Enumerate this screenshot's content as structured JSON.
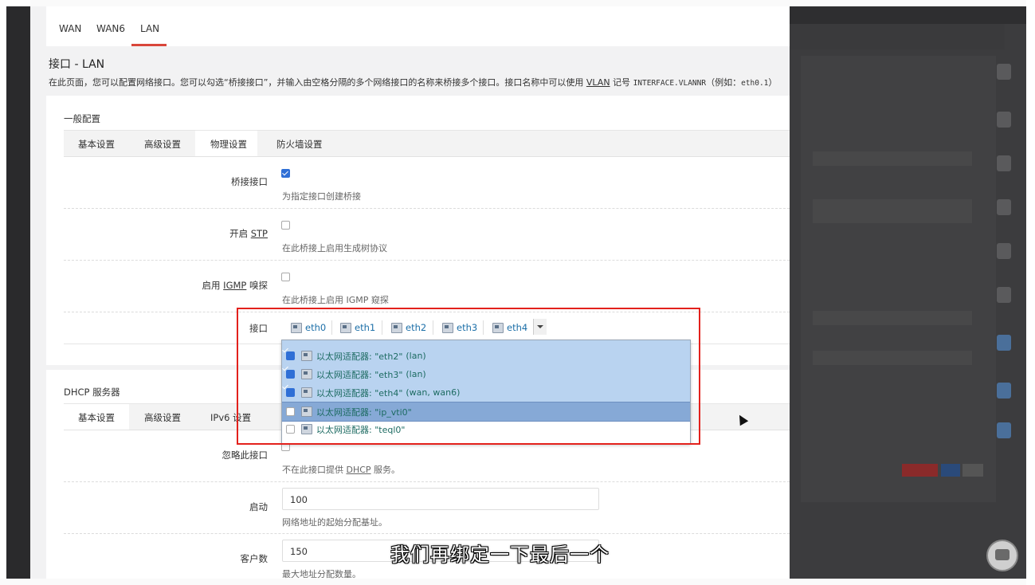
{
  "top_tabs": [
    {
      "label": "WAN"
    },
    {
      "label": "WAN6"
    },
    {
      "label": "LAN"
    }
  ],
  "page": {
    "title": "接口 - LAN",
    "desc_part1": "在此页面，您可以配置网络接口。您可以勾选“桥接接口”，并输入由空格分隔的多个网络接口的名称来桥接多个接口。接口名称中可以使用 ",
    "desc_vlan": "VLAN",
    "desc_part2": " 记号 ",
    "desc_mono": "INTERFACE.VLANNR",
    "desc_part3": "（例如：",
    "desc_mono2": "eth0.1",
    "desc_part4": "）"
  },
  "general": {
    "title": "一般配置",
    "tabs": [
      "基本设置",
      "高级设置",
      "物理设置",
      "防火墙设置"
    ],
    "active_tab": "物理设置",
    "bridge": {
      "label": "桥接接口",
      "checked": true,
      "hint": "为指定接口创建桥接"
    },
    "stp": {
      "label_pre": "开启 ",
      "label_u": "STP",
      "checked": false,
      "hint": "在此桥接上启用生成树协议"
    },
    "igmp": {
      "label_pre": "启用 ",
      "label_u": "IGMP",
      "label_post": " 嗅探",
      "checked": false,
      "hint": "在此桥接上启用 IGMP 窥探"
    },
    "iface": {
      "label": "接口",
      "chips": [
        "eth0",
        "eth1",
        "eth2",
        "eth3",
        "eth4"
      ],
      "options": [
        {
          "name": "以太网适配器: \"eth2\"",
          "tag": "(lan)",
          "checked": true,
          "state": "sel"
        },
        {
          "name": "以太网适配器: \"eth3\"",
          "tag": "(lan)",
          "checked": true,
          "state": "sel"
        },
        {
          "name": "以太网适配器: \"eth4\"",
          "tag": "(wan, wan6)",
          "checked": true,
          "state": "sel"
        },
        {
          "name": "以太网适配器: \"ip_vti0\"",
          "tag": "",
          "checked": false,
          "state": "hover"
        },
        {
          "name": "以太网适配器: \"teql0\"",
          "tag": "",
          "checked": false,
          "state": "normal"
        }
      ]
    }
  },
  "dhcp": {
    "title": "DHCP 服务器",
    "tabs": [
      "基本设置",
      "高级设置",
      "IPv6 设置"
    ],
    "active_tab": "基本设置",
    "ignore": {
      "label": "忽略此接口",
      "checked": false,
      "hint_pre": "不在此接口提供 ",
      "hint_u": "DHCP",
      "hint_post": " 服务。"
    },
    "start": {
      "label": "启动",
      "value": "100",
      "hint": "网络地址的起始分配基址。"
    },
    "limit": {
      "label": "客户数",
      "value": "150",
      "hint": "最大地址分配数量。"
    }
  },
  "overlay": {
    "subtitle": "我们再绑定一下最后一个"
  },
  "colors": {
    "accent": "#d9463a",
    "highlight_box": "#e3211c",
    "selected_row": "#b9d3f0",
    "hover_row": "#86a9d6"
  }
}
